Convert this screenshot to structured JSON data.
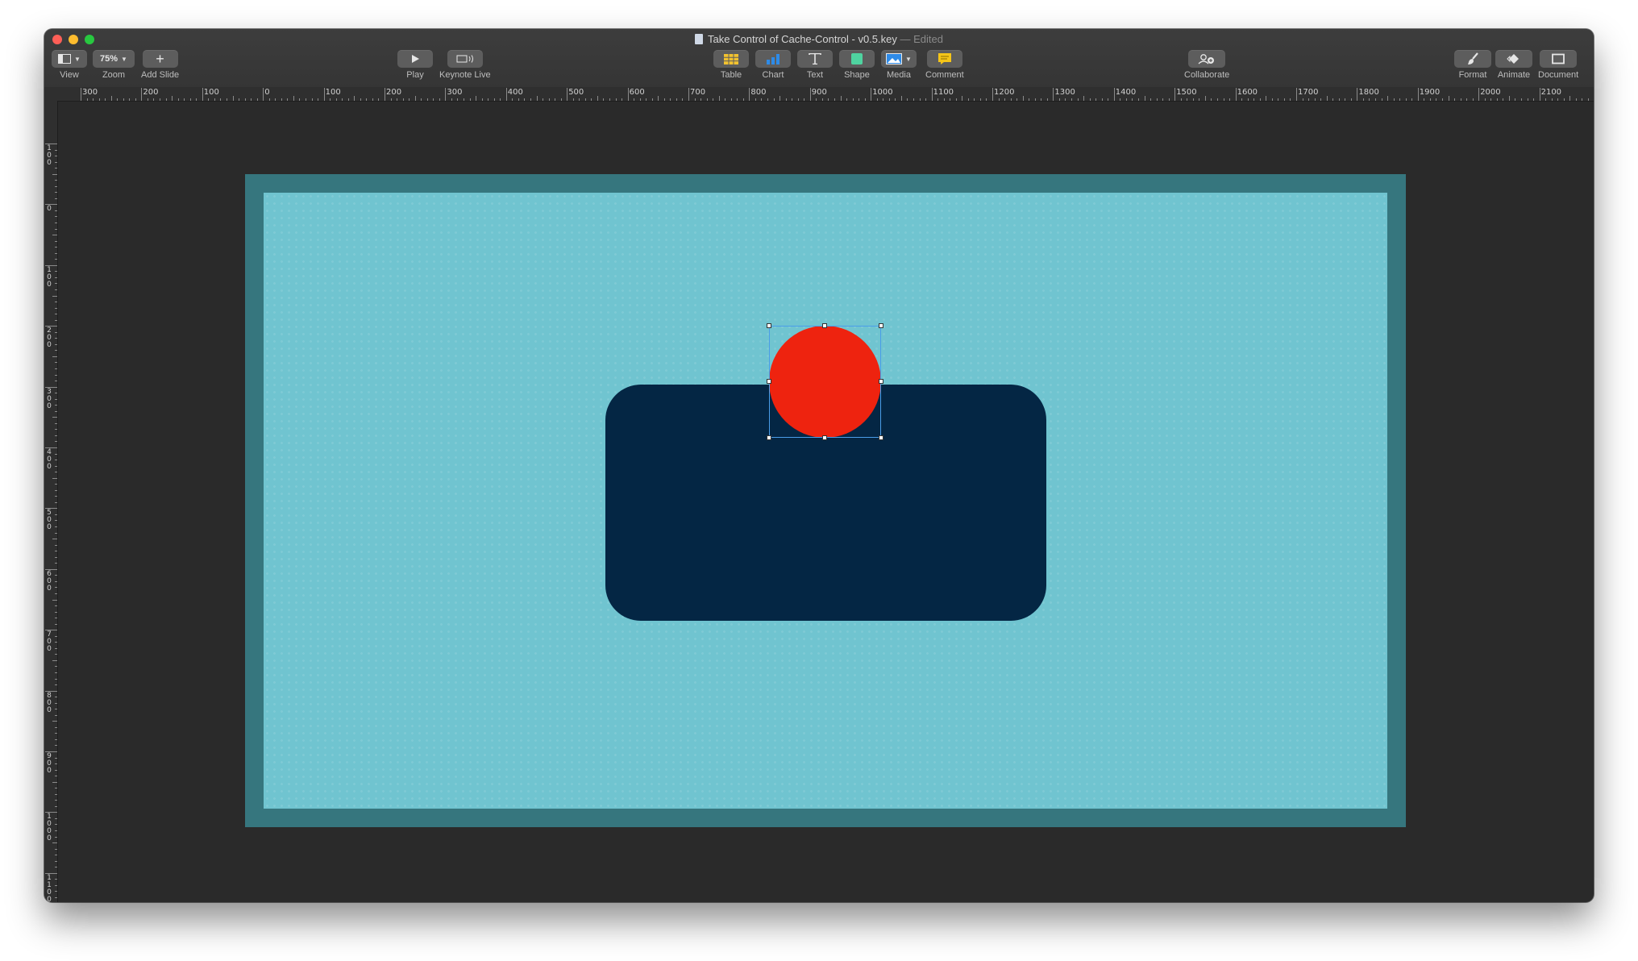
{
  "window": {
    "title": "Take Control of Cache-Control - v0.5.key",
    "edited_suffix": "— Edited"
  },
  "toolbar": {
    "view": {
      "label": "View"
    },
    "zoom": {
      "label": "Zoom",
      "value": "75%"
    },
    "add_slide": {
      "label": "Add Slide"
    },
    "play": {
      "label": "Play"
    },
    "keynote_live": {
      "label": "Keynote Live"
    },
    "table": {
      "label": "Table"
    },
    "chart": {
      "label": "Chart"
    },
    "text": {
      "label": "Text"
    },
    "shape": {
      "label": "Shape"
    },
    "media": {
      "label": "Media"
    },
    "comment": {
      "label": "Comment"
    },
    "collaborate": {
      "label": "Collaborate"
    },
    "format": {
      "label": "Format"
    },
    "animate": {
      "label": "Animate"
    },
    "document": {
      "label": "Document"
    }
  },
  "ruler": {
    "horizontal_labels": [
      "300",
      "200",
      "100",
      "0",
      "100",
      "200",
      "300",
      "400",
      "500",
      "600",
      "700",
      "800",
      "900",
      "1000",
      "1100",
      "1200",
      "1300",
      "1400",
      "1500",
      "1600",
      "1700",
      "1800",
      "1900",
      "2000",
      "2100",
      "220"
    ],
    "vertical_labels": [
      "100",
      "0",
      "100",
      "200",
      "300",
      "400",
      "500",
      "600",
      "700",
      "800",
      "900",
      "1000",
      "1100"
    ]
  },
  "slide": {
    "background_color": "#70c4d0",
    "frame_color": "#36767e",
    "rectangle_color": "#042644",
    "circle_color": "#ee230f",
    "circle_selected": true
  }
}
